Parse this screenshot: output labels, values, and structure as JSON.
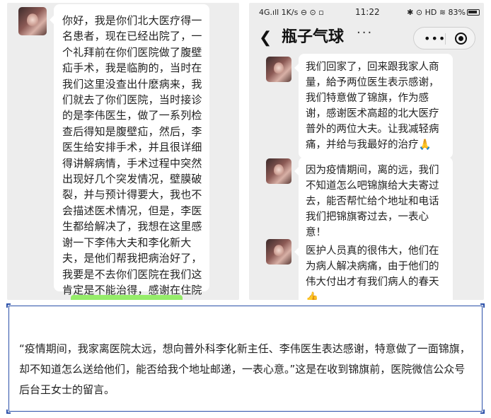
{
  "left_chat": {
    "message": "你好，我是你们北大医疗得一名患者，现在已经出院了，一个礼拜前在你们医院做了腹壁疝手术，我是临朐的，当时在我们这里没查出什麽病来，我们就去了你们医院，当时接诊的是李伟医生，做了一系列检查后得知是腹壁疝，然后，李医生给安排手术，并且很详细得讲解病情，手术过程中突然出现好几个突发情况，壁膜破裂，并与预计得要大，我也不会描述医术情况，但是，李医生都给解决了，我想在这里感谢一下李伟大夫和李化新大夫，是他们帮我把病治好了，我要是不去你们医院在我们这肯定是不能治得，感谢在住院的那段期间两位医生得精心治疗和外科得护士们的精心照顾。"
  },
  "right_chat": {
    "status": {
      "left": "4G.ıll 1K/s ⊖ ⊙ ▫",
      "time": "11:22",
      "right": "✱ ⊙ HD ≋ 83%"
    },
    "title": "瓶子气球",
    "more": "···",
    "capsule_more": "•••",
    "messages": [
      {
        "text": "我们回家了，回来跟我家人商量，給予两位医生表示感谢，我们特意做了锦旗，作为感谢，感谢医术高超的北大医疗普外的两位大夫。让我减轻病痛，并给与我最好的治疗🙏"
      },
      {
        "text": "因为疫情期间，离的远，我们不知道怎么吧锦旗给大夫寄过去，能否帮忙给个地址和电话我们把锦旗寄过去，一表心意！"
      },
      {
        "text": "医护人员真的很伟大，他们在为病人解决病痛，由于他们的伟大付出才有我们病人的春天👍"
      }
    ]
  },
  "caption": {
    "text": "“疫情期间，我家离医院太远，想向普外科李化新主任、李伟医生表达感谢，特意做了一面锦旗，却不知道怎么送给他们，能否给我个地址邮递，一表心意。”这是在收到锦旗前，医院微信公众号后台王女士的留言。"
  }
}
